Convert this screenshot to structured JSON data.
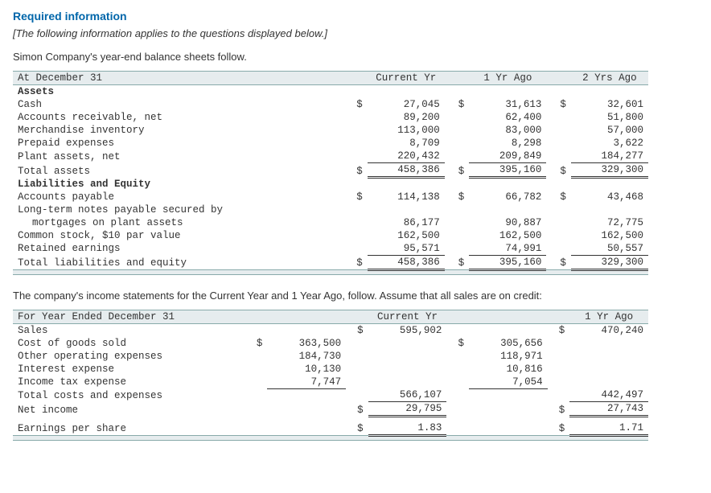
{
  "header": {
    "required": "Required information",
    "note": "[The following information applies to the questions displayed below.]",
    "intro": "Simon Company's year-end balance sheets follow."
  },
  "bs": {
    "title": "At December 31",
    "cols": {
      "c1": "Current Yr",
      "c2": "1 Yr Ago",
      "c3": "2 Yrs Ago"
    },
    "sections": {
      "assets": "Assets",
      "liab": "Liabilities and Equity"
    },
    "rows": {
      "cash": {
        "label": "Cash",
        "c1": "27,045",
        "c2": "31,613",
        "c3": "32,601"
      },
      "ar": {
        "label": "Accounts receivable, net",
        "c1": "89,200",
        "c2": "62,400",
        "c3": "51,800"
      },
      "inv": {
        "label": "Merchandise inventory",
        "c1": "113,000",
        "c2": "83,000",
        "c3": "57,000"
      },
      "prepaid": {
        "label": "Prepaid expenses",
        "c1": "8,709",
        "c2": "8,298",
        "c3": "3,622"
      },
      "plant": {
        "label": "Plant assets, net",
        "c1": "220,432",
        "c2": "209,849",
        "c3": "184,277"
      },
      "tassets": {
        "label": "Total assets",
        "c1": "458,386",
        "c2": "395,160",
        "c3": "329,300"
      },
      "ap": {
        "label": "Accounts payable",
        "c1": "114,138",
        "c2": "66,782",
        "c3": "43,468"
      },
      "ltn1": {
        "label": "Long-term notes payable secured by"
      },
      "ltn2": {
        "label": "mortgages on plant assets",
        "c1": "86,177",
        "c2": "90,887",
        "c3": "72,775"
      },
      "cs": {
        "label": "Common stock, $10 par value",
        "c1": "162,500",
        "c2": "162,500",
        "c3": "162,500"
      },
      "re": {
        "label": "Retained earnings",
        "c1": "95,571",
        "c2": "74,991",
        "c3": "50,557"
      },
      "tle": {
        "label": "Total liabilities and equity",
        "c1": "458,386",
        "c2": "395,160",
        "c3": "329,300"
      }
    },
    "dollar": "$"
  },
  "mid": "The company's income statements for the Current Year and 1 Year Ago, follow. Assume that all sales are on credit:",
  "is": {
    "title": "For Year Ended December 31",
    "cols": {
      "c1": "Current Yr",
      "c2": "1 Yr Ago"
    },
    "rows": {
      "sales": {
        "label": "Sales",
        "m1": "595,902",
        "m2": "470,240"
      },
      "cogs": {
        "label": "Cost of goods sold",
        "s1": "363,500",
        "s2": "305,656"
      },
      "opex": {
        "label": "Other operating expenses",
        "s1": "184,730",
        "s2": "118,971"
      },
      "intexp": {
        "label": "Interest expense",
        "s1": "10,130",
        "s2": "10,816"
      },
      "tax": {
        "label": "Income tax expense",
        "s1": "7,747",
        "s2": "7,054"
      },
      "tcosts": {
        "label": "Total costs and expenses",
        "m1": "566,107",
        "m2": "442,497"
      },
      "ni": {
        "label": "Net income",
        "m1": "29,795",
        "m2": "27,743"
      },
      "eps": {
        "label": "Earnings per share",
        "m1": "1.83",
        "m2": "1.71"
      }
    },
    "dollar": "$"
  }
}
